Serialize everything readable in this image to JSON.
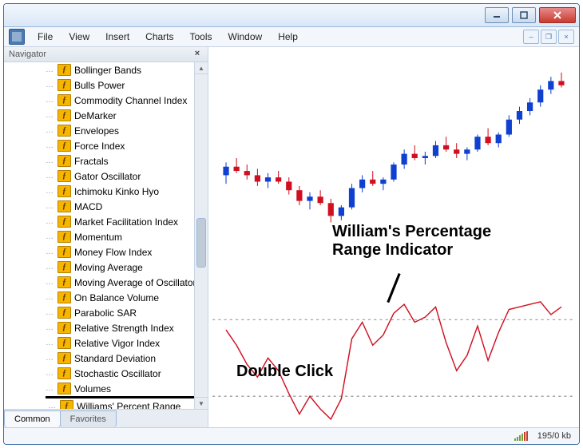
{
  "menu": {
    "items": [
      "File",
      "View",
      "Insert",
      "Charts",
      "Tools",
      "Window",
      "Help"
    ]
  },
  "navigator": {
    "title": "Navigator",
    "tabs": {
      "common": "Common",
      "favorites": "Favorites"
    },
    "indicators": [
      "Bollinger Bands",
      "Bulls Power",
      "Commodity Channel Index",
      "DeMarker",
      "Envelopes",
      "Force Index",
      "Fractals",
      "Gator Oscillator",
      "Ichimoku Kinko Hyo",
      "MACD",
      "Market Facilitation Index",
      "Momentum",
      "Money Flow Index",
      "Moving Average",
      "Moving Average of Oscillator",
      "On Balance Volume",
      "Parabolic SAR",
      "Relative Strength Index",
      "Relative Vigor Index",
      "Standard Deviation",
      "Stochastic Oscillator",
      "Volumes",
      "Williams' Percent Range"
    ]
  },
  "annotations": {
    "title_line1": "William's Percentage",
    "title_line2": "Range Indicator",
    "hint": "Double Click"
  },
  "status": {
    "transfer": "195/0 kb"
  },
  "chart_data": {
    "type": "candlestick+line",
    "price_panel": {
      "ylim": [
        0,
        100
      ],
      "candles": [
        {
          "x": 0,
          "o": 44,
          "h": 50,
          "l": 40,
          "c": 48,
          "up": true
        },
        {
          "x": 1,
          "o": 48,
          "h": 52,
          "l": 45,
          "c": 46,
          "up": false
        },
        {
          "x": 2,
          "o": 46,
          "h": 49,
          "l": 42,
          "c": 44,
          "up": false
        },
        {
          "x": 3,
          "o": 44,
          "h": 47,
          "l": 39,
          "c": 41,
          "up": false
        },
        {
          "x": 4,
          "o": 41,
          "h": 45,
          "l": 38,
          "c": 43,
          "up": true
        },
        {
          "x": 5,
          "o": 43,
          "h": 46,
          "l": 40,
          "c": 41,
          "up": false
        },
        {
          "x": 6,
          "o": 41,
          "h": 43,
          "l": 35,
          "c": 37,
          "up": false
        },
        {
          "x": 7,
          "o": 37,
          "h": 39,
          "l": 30,
          "c": 32,
          "up": false
        },
        {
          "x": 8,
          "o": 32,
          "h": 36,
          "l": 28,
          "c": 34,
          "up": true
        },
        {
          "x": 9,
          "o": 34,
          "h": 37,
          "l": 30,
          "c": 31,
          "up": false
        },
        {
          "x": 10,
          "o": 31,
          "h": 33,
          "l": 22,
          "c": 25,
          "up": false
        },
        {
          "x": 11,
          "o": 25,
          "h": 30,
          "l": 23,
          "c": 29,
          "up": true
        },
        {
          "x": 12,
          "o": 29,
          "h": 40,
          "l": 28,
          "c": 38,
          "up": true
        },
        {
          "x": 13,
          "o": 38,
          "h": 44,
          "l": 36,
          "c": 42,
          "up": true
        },
        {
          "x": 14,
          "o": 42,
          "h": 46,
          "l": 39,
          "c": 40,
          "up": false
        },
        {
          "x": 15,
          "o": 40,
          "h": 43,
          "l": 37,
          "c": 42,
          "up": true
        },
        {
          "x": 16,
          "o": 42,
          "h": 50,
          "l": 41,
          "c": 49,
          "up": true
        },
        {
          "x": 17,
          "o": 49,
          "h": 56,
          "l": 47,
          "c": 54,
          "up": true
        },
        {
          "x": 18,
          "o": 54,
          "h": 58,
          "l": 51,
          "c": 52,
          "up": false
        },
        {
          "x": 19,
          "o": 52,
          "h": 55,
          "l": 49,
          "c": 53,
          "up": true
        },
        {
          "x": 20,
          "o": 53,
          "h": 60,
          "l": 52,
          "c": 58,
          "up": true
        },
        {
          "x": 21,
          "o": 58,
          "h": 62,
          "l": 55,
          "c": 56,
          "up": false
        },
        {
          "x": 22,
          "o": 56,
          "h": 59,
          "l": 52,
          "c": 54,
          "up": false
        },
        {
          "x": 23,
          "o": 54,
          "h": 57,
          "l": 51,
          "c": 56,
          "up": true
        },
        {
          "x": 24,
          "o": 56,
          "h": 63,
          "l": 55,
          "c": 62,
          "up": true
        },
        {
          "x": 25,
          "o": 62,
          "h": 66,
          "l": 58,
          "c": 59,
          "up": false
        },
        {
          "x": 26,
          "o": 59,
          "h": 64,
          "l": 57,
          "c": 63,
          "up": true
        },
        {
          "x": 27,
          "o": 63,
          "h": 72,
          "l": 62,
          "c": 70,
          "up": true
        },
        {
          "x": 28,
          "o": 70,
          "h": 76,
          "l": 68,
          "c": 74,
          "up": true
        },
        {
          "x": 29,
          "o": 74,
          "h": 80,
          "l": 72,
          "c": 78,
          "up": true
        },
        {
          "x": 30,
          "o": 78,
          "h": 86,
          "l": 76,
          "c": 84,
          "up": true
        },
        {
          "x": 31,
          "o": 84,
          "h": 90,
          "l": 82,
          "c": 88,
          "up": true
        },
        {
          "x": 32,
          "o": 88,
          "h": 92,
          "l": 85,
          "c": 86,
          "up": false
        }
      ]
    },
    "indicator_panel": {
      "name": "Williams' Percent Range",
      "ylim": [
        -100,
        0
      ],
      "levels": [
        -20,
        -80
      ],
      "series": [
        -28,
        -40,
        -55,
        -65,
        -50,
        -60,
        -78,
        -94,
        -80,
        -90,
        -98,
        -82,
        -35,
        -22,
        -40,
        -32,
        -15,
        -8,
        -22,
        -18,
        -10,
        -38,
        -60,
        -48,
        -25,
        -52,
        -30,
        -12,
        -10,
        -8,
        -6,
        -16,
        -10
      ]
    }
  }
}
